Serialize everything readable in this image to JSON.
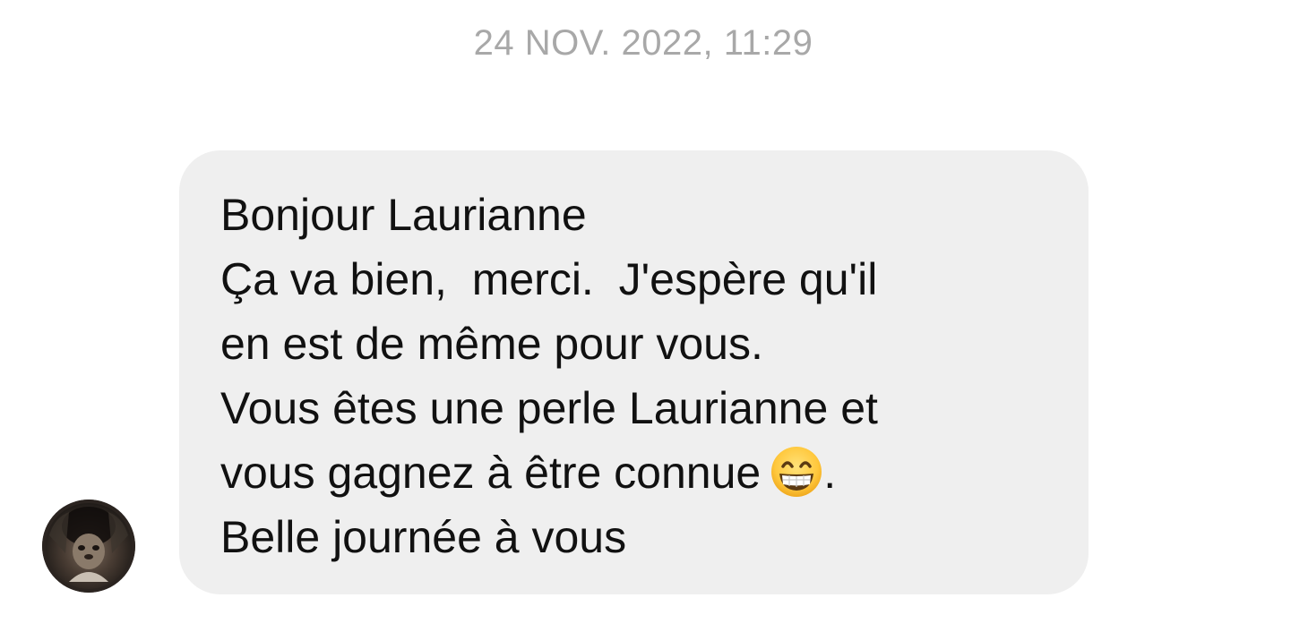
{
  "conversation": {
    "timestamp": "24 NOV. 2022, 11:29"
  },
  "message": {
    "lines": [
      "Bonjour Laurianne",
      "Ça va bien,  merci.  J'espère qu'il",
      "en est de même pour vous.",
      "Vous êtes une perle Laurianne et",
      "vous gagnez à être connue",
      ".",
      "Belle journée à vous"
    ],
    "emoji": "grinning-face-with-smiling-eyes"
  },
  "sender": {
    "avatar_icon": "profile-photo"
  },
  "colors": {
    "bubble_bg": "#efefef",
    "timestamp": "#a8a8a8",
    "text": "#111111"
  }
}
